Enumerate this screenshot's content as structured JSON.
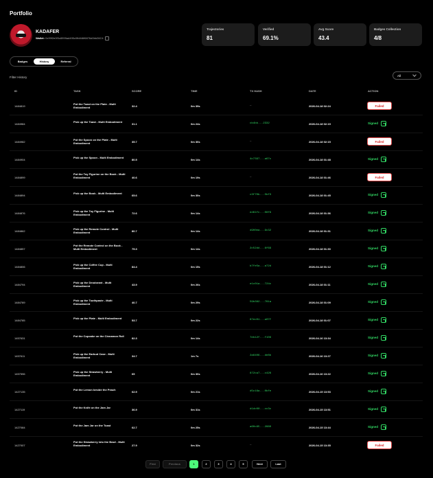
{
  "page": {
    "title": "Portfolio"
  },
  "profile": {
    "username": "KADAFER",
    "wallet_label": "Wallet:",
    "wallet_address": "0x99f2e0f3c8999ad495c0fb846f6876d0bb26C4"
  },
  "stats": [
    {
      "label": "Trajectories",
      "value": "81"
    },
    {
      "label": "Verified",
      "value": "69.1%"
    },
    {
      "label": "Avg Score",
      "value": "43.4"
    },
    {
      "label": "Badges Collection",
      "value": "4/8"
    }
  ],
  "tabs": [
    "Badges",
    "History",
    "Referral"
  ],
  "active_tab": "History",
  "filter": {
    "label": "Filter History",
    "selected": "All"
  },
  "table": {
    "headers": [
      "ID",
      "TASK",
      "SCORE",
      "TIME",
      "TX HASH",
      "DATE",
      "ACTION"
    ],
    "rows": [
      {
        "id": "1484819",
        "task": "Put the Toast on the Plate - Multi Embodiment",
        "score": "32.4",
        "time": "0m 39s",
        "tx": "—",
        "date": "2026-04-18 02:24",
        "action": "Failed"
      },
      {
        "id": "1484984",
        "task": "Pick up the Toast - Multi Embodiment",
        "score": "31.1",
        "time": "0m 24s",
        "tx": "cb4bb...2332",
        "date": "2026-04-18 02:19",
        "action": "Signed"
      },
      {
        "id": "1484982",
        "task": "Put the Spoon on the Plate - Multi Embodiment",
        "score": "35.7",
        "time": "0m 30s",
        "tx": "—",
        "date": "2026-04-18 02:15",
        "action": "Failed"
      },
      {
        "id": "1484904",
        "task": "Pick up the Spoon - Multi Embodiment",
        "score": "80.5",
        "time": "0m 14s",
        "tx": "4c7397...a67c",
        "date": "2026-04-18 01:48",
        "action": "Signed"
      },
      {
        "id": "1484899",
        "task": "Put the Toy Figurine on the Book - Multi Embodiment",
        "score": "40.6",
        "time": "0m 19s",
        "tx": "—",
        "date": "2026-04-18 01:46",
        "action": "Failed"
      },
      {
        "id": "1484894",
        "task": "Pick up the Book - Multi Embodiment",
        "score": "65.6",
        "time": "0m 30s",
        "tx": "c3f70b...5bf3",
        "date": "2026-04-18 01:45",
        "action": "Signed"
      },
      {
        "id": "1484876",
        "task": "Pick up the Toy Figurine - Multi Embodiment",
        "score": "72.6",
        "time": "0m 14s",
        "tx": "ed61fc...08f9",
        "date": "2026-04-18 01:36",
        "action": "Signed"
      },
      {
        "id": "1484862",
        "task": "Pick up the Remote Control - Multi Embodiment",
        "score": "80.7",
        "time": "0m 14s",
        "tx": "d900ea...9c32",
        "date": "2026-04-18 01:31",
        "action": "Signed"
      },
      {
        "id": "1484857",
        "task": "Put the Remote Control on the Book - Multi Embodiment",
        "score": "75.3",
        "time": "0m 14s",
        "tx": "2c52dd...6f69",
        "date": "2026-04-18 01:30",
        "action": "Signed"
      },
      {
        "id": "1484806",
        "task": "Pick up the Coffee Cup - Multi Embodiment",
        "score": "84.4",
        "time": "0m 15s",
        "tx": "b7fe5a...a72d",
        "date": "2026-04-18 01:12",
        "action": "Signed"
      },
      {
        "id": "1484794",
        "task": "Pick up the Deodorant - Multi Embodiment",
        "score": "43.9",
        "time": "0m 26s",
        "tx": "e1c01a...724c",
        "date": "2026-04-18 01:11",
        "action": "Signed"
      },
      {
        "id": "1484789",
        "task": "Pick up the Toothpaste - Multi Embodiment",
        "score": "40.7",
        "time": "0m 29s",
        "tx": "59b382...761a",
        "date": "2026-04-18 01:09",
        "action": "Signed"
      },
      {
        "id": "1484785",
        "task": "Pick up the Plate - Multi Embodiment",
        "score": "53.7",
        "time": "0m 22s",
        "tx": "67ec01...a07f",
        "date": "2026-04-18 01:07",
        "action": "Signed"
      },
      {
        "id": "1457631",
        "task": "Put the Cupcake on the Cinnamon Roll",
        "score": "82.3",
        "time": "0m 14s",
        "tx": "7eb12f...f106",
        "date": "2026-04-16 13:34",
        "action": "Signed"
      },
      {
        "id": "1457611",
        "task": "Pick up the Earbud Case - Multi Embodiment",
        "score": "34.7",
        "time": "1m 7s",
        "tx": "2a6406...de8b",
        "date": "2026-04-16 13:27",
        "action": "Signed"
      },
      {
        "id": "1457596",
        "task": "Pick up the Strawberry - Multi Embodiment",
        "score": "65",
        "time": "0m 30s",
        "tx": "872ca7...c426",
        "date": "2026-04-16 13:22",
        "action": "Signed"
      },
      {
        "id": "1427135",
        "task": "Put the Lemon beside the Peach",
        "score": "62.9",
        "time": "0m 21s",
        "tx": "d5c16a...0bfe",
        "date": "2026-04-15 13:53",
        "action": "Signed"
      },
      {
        "id": "1427119",
        "task": "Put the Knife on the Jam Jar",
        "score": "36.9",
        "time": "0m 31s",
        "tx": "d1dc00...cc3c",
        "date": "2026-04-15 13:51",
        "action": "Signed"
      },
      {
        "id": "1427084",
        "task": "Put the Jam Jar on the Toast",
        "score": "62.7",
        "time": "0m 25s",
        "tx": "a60c95...2880",
        "date": "2026-04-15 13:44",
        "action": "Signed"
      },
      {
        "id": "1427007",
        "task": "Put the Strawberry into the Bowl - Multi Embodiment",
        "score": "27.9",
        "time": "0m 32s",
        "tx": "—",
        "date": "2026-04-15 13:35",
        "action": "Failed"
      }
    ]
  },
  "pagination": {
    "first": "First",
    "previous": "Previous",
    "pages": [
      "1",
      "2",
      "3",
      "4",
      "5"
    ],
    "current": "1",
    "next": "Next",
    "last": "Last"
  },
  "colors": {
    "background": "#000000",
    "card": "#1c1c1c",
    "signed": "#33dd66",
    "failed": "#d62020",
    "active_page": "#4dfa7a"
  }
}
